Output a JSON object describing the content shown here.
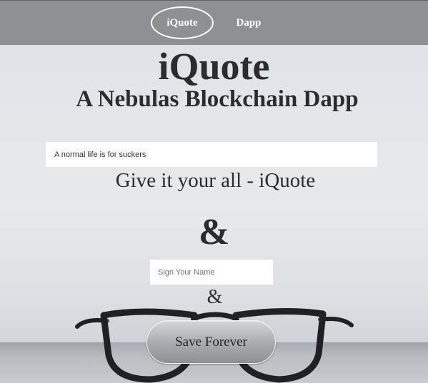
{
  "nav": {
    "items": [
      {
        "label": "iQuote",
        "active": true
      },
      {
        "label": "Dapp",
        "active": false
      }
    ]
  },
  "header": {
    "title": "iQuote",
    "subtitle": "A Nebulas Blockchain Dapp"
  },
  "form": {
    "quote_value": "A normal life is for suckers",
    "quote_placeholder": "",
    "quote_preview": "Give it your all - iQuote",
    "ampersand_large": "&",
    "name_value": "",
    "name_placeholder": "Sign Your Name",
    "ampersand_small": "&",
    "save_label": "Save Forever"
  },
  "colors": {
    "nav_background": "#8e9094",
    "text": "#2a2c30",
    "button_gradient_top": "#d4d6d9",
    "button_gradient_bottom": "#8d9094"
  },
  "background": {
    "description_icon": "eyeglasses-on-table"
  }
}
